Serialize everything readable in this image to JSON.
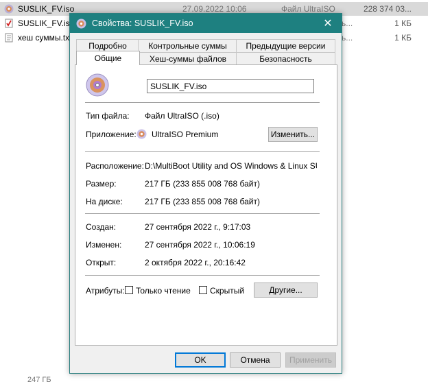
{
  "explorer": {
    "rows": [
      {
        "name": "SUSLIK_FV.iso",
        "date": "27.09.2022 10:06",
        "type": "Файл UltraISO",
        "size": "228 374 03..."
      },
      {
        "name": "SUSLIK_FV.iso.",
        "suffix": "ь...",
        "size": "1 КБ"
      },
      {
        "name": "хеш суммы.tx",
        "suffix": "ь...",
        "size": "1 КБ"
      }
    ],
    "bottom_text": "247 ГБ"
  },
  "dialog": {
    "title": "Свойства: SUSLIK_FV.iso",
    "close": "✕",
    "tabs_top": [
      "Подробно",
      "Контрольные суммы",
      "Предыдущие версии"
    ],
    "tabs_bottom": [
      "Общие",
      "Хеш-суммы файлов",
      "Безопасность"
    ],
    "file_name": "SUSLIK_FV.iso",
    "file_type_label": "Тип файла:",
    "file_type_value": "Файл UltraISO (.iso)",
    "app_label": "Приложение:",
    "app_value": "UltraISO Premium",
    "change_button": "Изменить...",
    "location_label": "Расположение:",
    "location_value": "D:\\MultiBoot Utility and OS Windows & Linux SUSLIk",
    "size_label": "Размер:",
    "size_value": "217 ГБ (233 855 008 768 байт)",
    "disk_label": "На диске:",
    "disk_value": "217 ГБ (233 855 008 768 байт)",
    "created_label": "Создан:",
    "created_value": "27 сентября 2022 г., 9:17:03",
    "modified_label": "Изменен:",
    "modified_value": "27 сентября 2022 г., 10:06:19",
    "opened_label": "Открыт:",
    "opened_value": "2 октября 2022 г., 20:16:42",
    "attributes_label": "Атрибуты:",
    "readonly_label": "Только чтение",
    "hidden_label": "Скрытый",
    "other_button": "Другие...",
    "ok_button": "OK",
    "cancel_button": "Отмена",
    "apply_button": "Применить"
  }
}
